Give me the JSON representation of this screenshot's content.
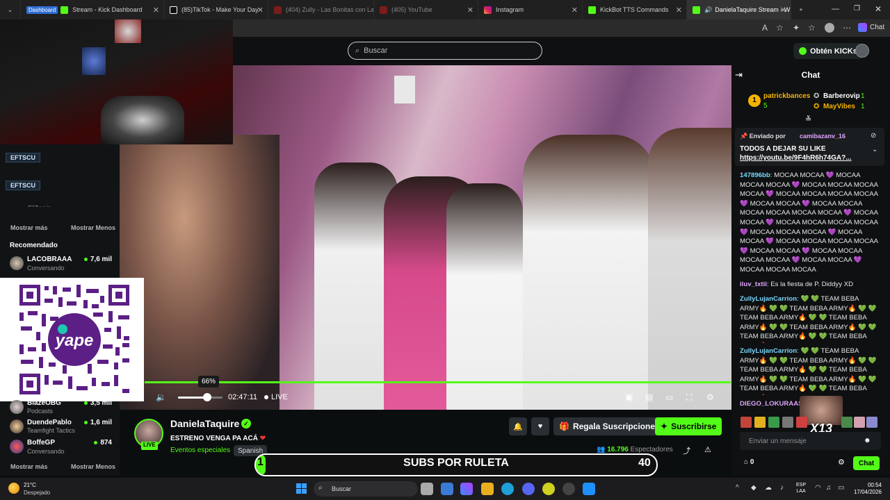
{
  "browser": {
    "tabs": [
      {
        "label": "Stream - Kick Dashboard",
        "badge": "Dashboard"
      },
      {
        "label": "(85)TikTok - Make Your Day"
      },
      {
        "label": "(404) Zully - Las Bonitas con La"
      },
      {
        "label": "(405) YouTube"
      },
      {
        "label": "Instagram"
      },
      {
        "label": "KickBot TTS Commands"
      },
      {
        "label": "DanielaTaquire Stream - W"
      }
    ],
    "chat_toolbar_label": "Chat"
  },
  "header": {
    "search_placeholder": "Buscar",
    "get_kicks_label": "Obtén KICKs"
  },
  "sidebar": {
    "ghost_tags": [
      "EFTSCU",
      "EFTSCU"
    ],
    "ghost_user": "ElZeein",
    "show_more": "Mostrar más",
    "show_less": "Mostrar Menos",
    "recommended_title": "Recomendado",
    "recommended": [
      {
        "name": "LACOBRAAA",
        "category": "Conversando",
        "viewers": "7,6 mil"
      },
      {
        "name": "BlazeOBG",
        "category": "Podcasts",
        "viewers": "3,5 mil"
      },
      {
        "name": "DuendePablo",
        "category": "Teamfight Tactics",
        "viewers": "1,6 mil"
      },
      {
        "name": "BoffeGP",
        "category": "Conversando",
        "viewers": "874"
      }
    ],
    "show_more_2": "Mostrar más",
    "show_less_2": "Mostrar Menos"
  },
  "player": {
    "volume_percent": 66,
    "volume_tooltip": "66%",
    "time": "02:47:11",
    "live_label": "LIVE"
  },
  "stream": {
    "streamer": "DanielaTaquire",
    "avatar_live": "LIVE",
    "title": "ESTRENO VENGA PA ACÁ",
    "category": "Eventos especiales",
    "language": "Spanish",
    "gift_label": "Regala Suscripciones",
    "subscribe_label": "Suscribirse",
    "viewers": "16.796",
    "viewers_label": "Espectadores"
  },
  "ruleta": {
    "current": "1",
    "label": "SUBS POR RULETA",
    "goal": "40",
    "progress_fraction": 0.025
  },
  "chat": {
    "title": "Chat",
    "leaderboard": [
      {
        "rank": "1",
        "name": "patrickbances",
        "count": "5",
        "color": "#f5b301"
      },
      {
        "name": "Barberovip",
        "count": "1",
        "color": "#ffffff"
      },
      {
        "name": "MayVibes",
        "count": "1",
        "color": "#f5b301"
      }
    ],
    "pinned_by_label": "Enviado por",
    "pinned_user": "camibazanv_16",
    "pinned_text": "TODOS A DEJAR SU LIKE",
    "pinned_link": "https://youtu.be/9F4hR6h74GA?...",
    "messages": [
      {
        "user": "147896bb",
        "color": "#7ad7ff",
        "text": "MOCAA MOCAA 💜 MOCAA MOCAA MOCAA 💜 MOCAA MOCAA MOCAA MOCAA 💜 MOCAA MOCAA MOCAA MOCAA 💜 MOCAA MOCAA 💜 MOCAA MOCAA MOCAA MOCAA MOCAA MOCAA 💜 MOCAA MOCAA 💜 MOCAA MOCAA MOCAA MOCAA 💜 MOCAA MOCAA MOCAA 💜 MOCAA MOCAA 💜 MOCAA MOCAA MOCAA MOCAA 💜 MOCAA MOCAA 💜 MOCAA MOCAA MOCAA MOCAA 💜 MOCAA MOCAA 💜 MOCAA MOCAA MOCAA"
      },
      {
        "user": "iluv_txtii",
        "color": "#e0a4ff",
        "text": "Es la fiesta de P. Diddyy XD"
      },
      {
        "user": "ZullyLujanCarrion",
        "color": "#7ad7ff",
        "text": "💚 💚 TEAM BEBA ARMY🔥 💚 💚 TEAM BEBA ARMY🔥 💚 💚 TEAM BEBA ARMY🔥 💚 💚 TEAM BEBA ARMY🔥 💚 💚 TEAM BEBA ARMY🔥 💚 💚 TEAM BEBA ARMY🔥 💚 💚 TEAM BEBA ARMY🔥"
      },
      {
        "user": "ZullyLujanCarrion",
        "color": "#7ad7ff",
        "text": "💚 💚 TEAM BEBA ARMY🔥 💚 💚 TEAM BEBA ARMY🔥 💚 💚 TEAM BEBA ARMY🔥 💚 💚 TEAM BEBA ARMY🔥 💚 💚 TEAM BEBA ARMY🔥 💚 💚 TEAM BEBA ARMY🔥 💚 💚 TEAM BEBA ARMY🔥"
      },
      {
        "user": "DIEGO_LOKURAAS",
        "color": "#e0a4ff",
        "text": ""
      }
    ],
    "emote_overlay": "X13",
    "input_placeholder": "Enviar un mensaje",
    "points": "0",
    "send_label": "Chat"
  },
  "taskbar": {
    "temperature": "21°C",
    "weather": "Despejado",
    "search_placeholder": "Buscar",
    "lang_line1": "ESP",
    "lang_line2": "LAA",
    "time": "00:54",
    "date": "17/04/2026"
  },
  "colors": {
    "accent": "#53fc18",
    "background": "#0b0e0f"
  }
}
